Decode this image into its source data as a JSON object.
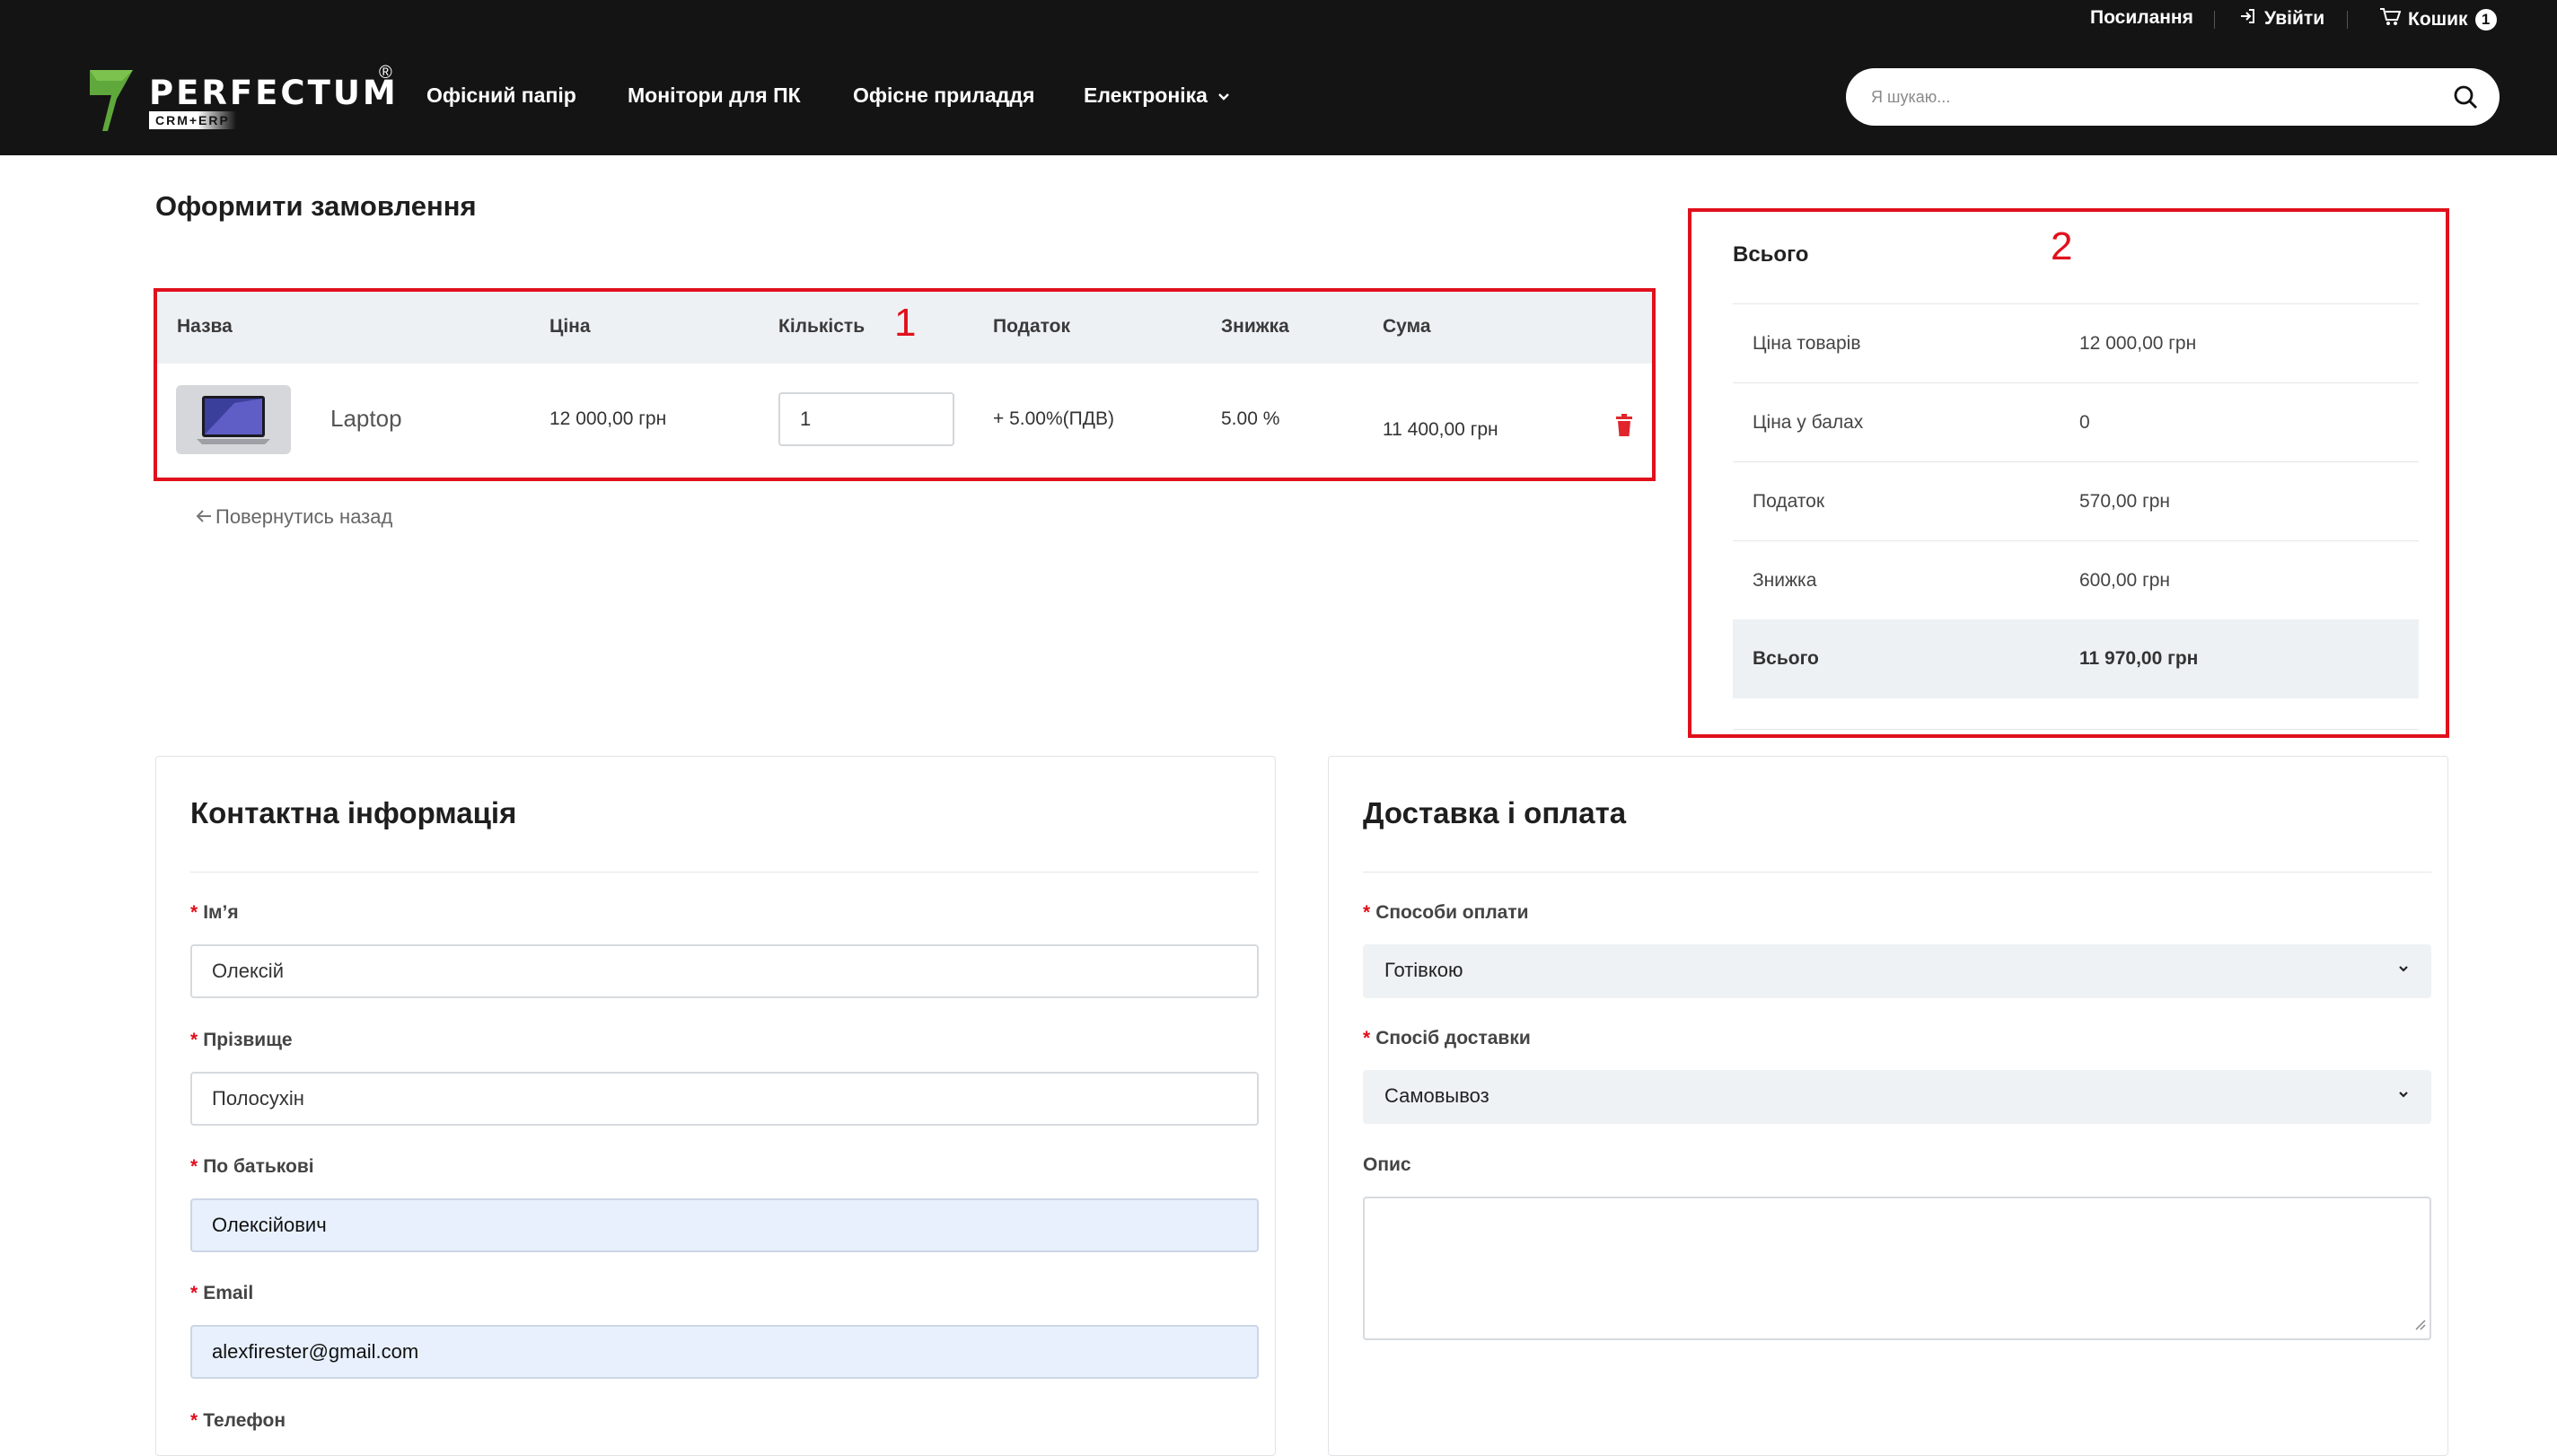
{
  "topbar": {
    "links_label": "Посилання",
    "login_label": "Увійти",
    "cart_label": "Кошик",
    "cart_count": "1"
  },
  "header": {
    "logo_text": "PERFECTUM",
    "logo_sub": "CRM+ERP",
    "logo_reg": "®",
    "nav": [
      "Офісний папір",
      "Монітори для ПК",
      "Офісне приладдя",
      "Електроніка"
    ],
    "search_placeholder": "Я шукаю..."
  },
  "page": {
    "title": "Оформити замовлення"
  },
  "cart": {
    "annotation": "1",
    "headers": {
      "name": "Назва",
      "price": "Ціна",
      "qty": "Кількість",
      "tax": "Податок",
      "discount": "Знижка",
      "sum": "Сума"
    },
    "items": [
      {
        "name": "Laptop",
        "price": "12 000,00 грн",
        "qty": "1",
        "tax": "+ 5.00%(ПДВ)",
        "discount": "5.00 %",
        "sum": "11 400,00 грн"
      }
    ],
    "back_label": "Повернутись назад"
  },
  "summary": {
    "annotation": "2",
    "title": "Всього",
    "rows": [
      {
        "label": "Ціна товарів",
        "value": "12 000,00 грн"
      },
      {
        "label": "Ціна у балах",
        "value": "0"
      },
      {
        "label": "Податок",
        "value": "570,00 грн"
      },
      {
        "label": "Знижка",
        "value": "600,00 грн"
      }
    ],
    "total": {
      "label": "Всього",
      "value": "11 970,00 грн"
    }
  },
  "contact": {
    "title": "Контактна інформація",
    "fields": [
      {
        "label": "Ім’я",
        "value": "Олексій"
      },
      {
        "label": "Прізвище",
        "value": "Полосухін"
      },
      {
        "label": "По батькові",
        "value": "Олексійович"
      },
      {
        "label": "Email",
        "value": "alexfirester@gmail.com"
      },
      {
        "label": "Телефон",
        "value": ""
      }
    ]
  },
  "delivery": {
    "title": "Доставка і оплата",
    "payment_label": "Способи оплати",
    "payment_value": "Готівкою",
    "shipping_label": "Спосіб доставки",
    "shipping_value": "Самовывоз",
    "description_label": "Опис"
  },
  "colors": {
    "header_bg": "#141414",
    "annotation_red": "#e0101c",
    "delete_red": "#e0262c",
    "logo_green": "#5fa83b",
    "autofill_blue": "#e8f0fe"
  }
}
